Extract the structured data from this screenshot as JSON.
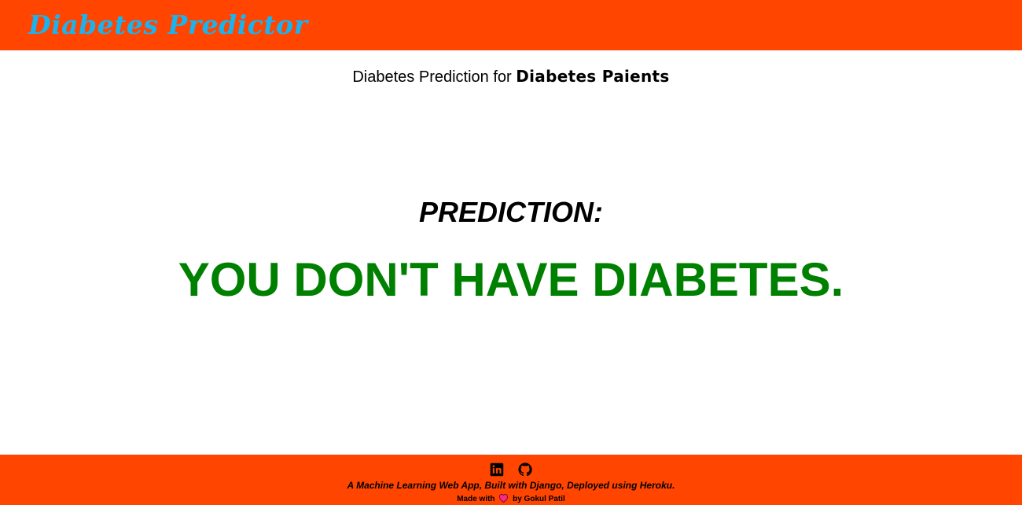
{
  "header": {
    "brand": "Diabetes Predictor",
    "brand_color": "#19b4f0",
    "background": "#ff4500"
  },
  "subtitle": {
    "prefix": "Diabetes Prediction for",
    "emphasis": "Diabetes Paients"
  },
  "prediction": {
    "label": "PREDICTION:",
    "result": "YOU DON'T HAVE DIABETES.",
    "result_color": "#008000"
  },
  "footer": {
    "background": "#ff4500",
    "social_icons": [
      "linkedin-icon",
      "github-icon"
    ],
    "tagline": "A Machine Learning Web App, Built with Django, Deployed using Heroku.",
    "credit_prefix": "Made with",
    "credit_icon": "heart-icon",
    "credit_suffix": "by Gokul Patil"
  }
}
